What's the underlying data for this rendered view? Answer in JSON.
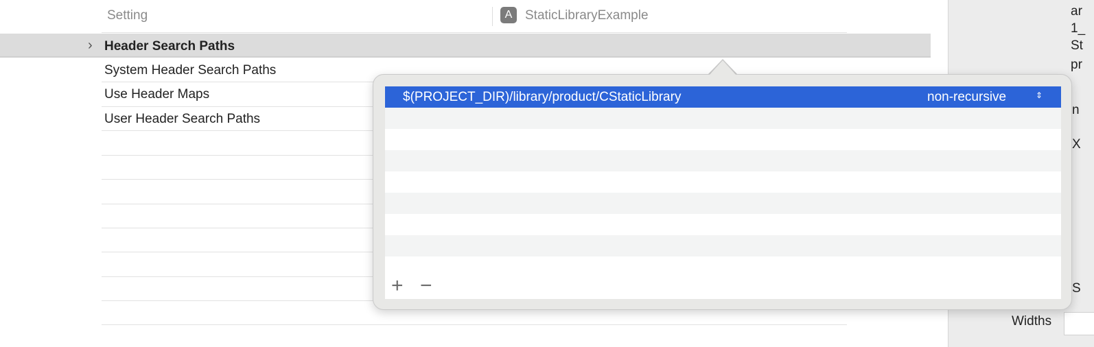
{
  "header": {
    "setting_col": "Setting",
    "target_col": "StaticLibraryExample",
    "target_icon": "app-store-icon"
  },
  "settings": [
    {
      "label": "Header Search Paths",
      "expanded": false,
      "selected": true
    },
    {
      "label": "System Header Search Paths"
    },
    {
      "label": "Use Header Maps"
    },
    {
      "label": "User Header Search Paths"
    }
  ],
  "popover": {
    "paths": [
      {
        "path": "$(PROJECT_DIR)/library/product/CStaticLibrary",
        "mode": "non-recursive"
      }
    ],
    "add_label": "+",
    "remove_label": "−"
  },
  "inspector": {
    "fragments": [
      "ar",
      "1_",
      "St",
      "pr",
      "n",
      "X",
      "S"
    ],
    "widths_label": "Widths"
  },
  "colors": {
    "selection": "#2c64d8",
    "row_selected": "#dcdcdc"
  }
}
